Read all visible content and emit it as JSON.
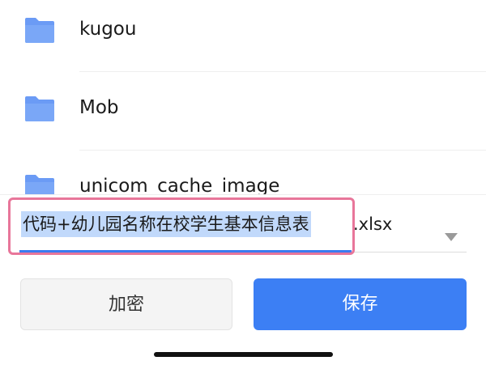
{
  "file_list": {
    "folders": [
      {
        "name": "kugou",
        "icon": "folder-icon"
      },
      {
        "name": "Mob",
        "icon": "folder-icon"
      },
      {
        "name": "unicom_cache_image",
        "icon": "folder-icon"
      }
    ]
  },
  "save_dialog": {
    "filename_selected": "代码+幼儿园名称在校学生基本信息表",
    "filename_extension": ".xlsx",
    "dropdown_icon": "triangle-down-icon",
    "encrypt_label": "加密",
    "save_label": "保存"
  },
  "colors": {
    "folder": "#6b9bf5",
    "accent": "#3c7ff4",
    "selection": "#c1d9fb",
    "highlight_box": "#e8769a"
  }
}
